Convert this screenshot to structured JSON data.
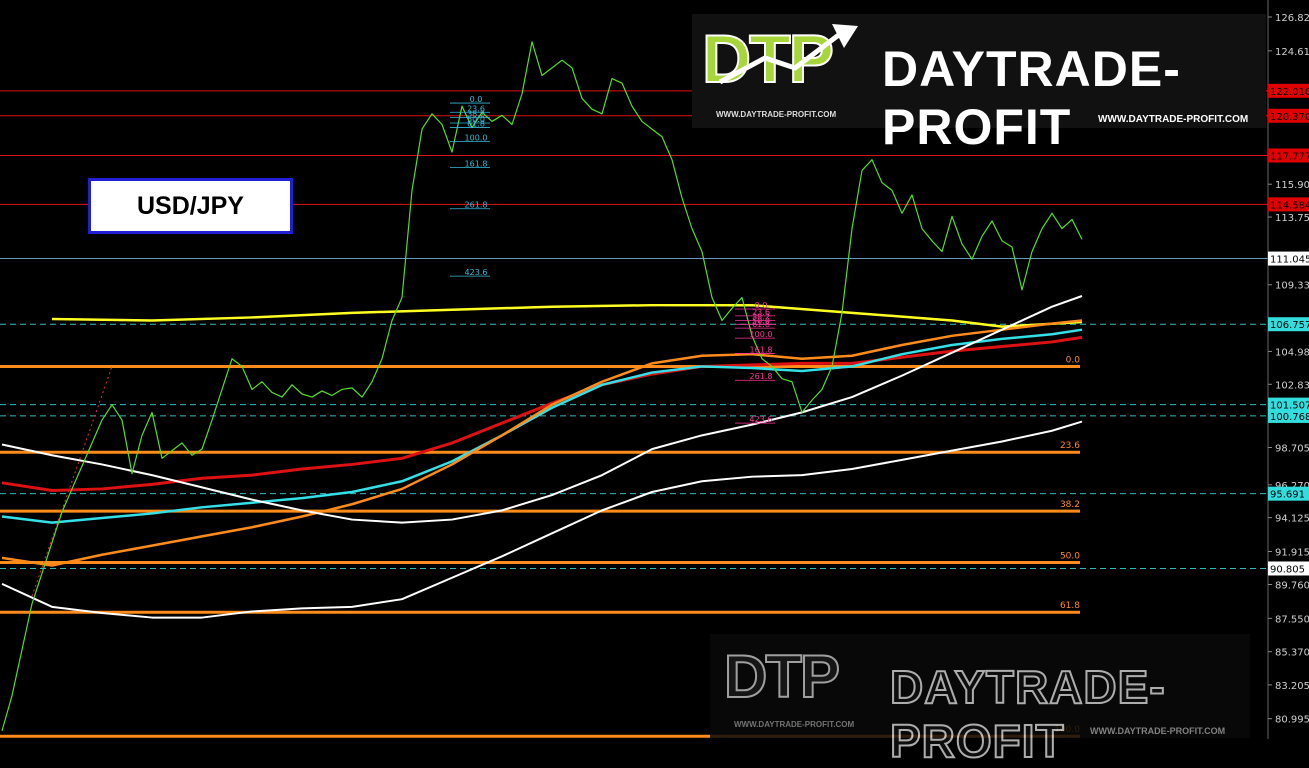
{
  "instrument": {
    "label": "USD/JPY"
  },
  "brand": {
    "name": "DAYTRADE-PROFIT",
    "mark": "DTP",
    "url": "WWW.DAYTRADE-PROFIT.COM",
    "url_small": "WWW.DAYTRADE-PROFIT.COM",
    "accent": "#a6d63a"
  },
  "chart_data": {
    "type": "line",
    "ylim": [
      79.8,
      127.8
    ],
    "y_ticks": [
      "126.820",
      "124.610",
      "122.010",
      "120.370",
      "117.777",
      "115.900",
      "113.755",
      "111.045",
      "109.335",
      "106.757",
      "104.980",
      "102.835",
      "101.507",
      "100.768",
      "98.705",
      "96.270",
      "95.691",
      "94.125",
      "91.915",
      "90.805",
      "89.760",
      "87.550",
      "85.370",
      "83.205",
      "80.995"
    ],
    "y_ticks_plain": [
      "126.820",
      "124.610",
      "115.900",
      "113.755",
      "109.335",
      "104.980",
      "102.835",
      "98.705",
      "96.270",
      "94.125",
      "91.915",
      "89.760",
      "87.550",
      "85.370",
      "83.205",
      "80.995"
    ],
    "price_labels": [
      {
        "text": "122.010",
        "value": 122.0,
        "color": "#e00000"
      },
      {
        "text": "120.370",
        "value": 120.37,
        "color": "#e00000"
      },
      {
        "text": "117.777",
        "value": 117.777,
        "color": "#e00000"
      },
      {
        "text": "114.584",
        "value": 114.584,
        "color": "#e00000"
      },
      {
        "text": "111.045",
        "value": 111.045,
        "color": "#ffffff"
      },
      {
        "text": "106.757",
        "value": 106.757,
        "color": "#33dddd"
      },
      {
        "text": "101.507",
        "value": 101.507,
        "color": "#33dddd"
      },
      {
        "text": "100.768",
        "value": 100.768,
        "color": "#33dddd"
      },
      {
        "text": "95.691",
        "value": 95.691,
        "color": "#33dddd"
      },
      {
        "text": "90.805",
        "value": 90.805,
        "color": "#ffffff"
      }
    ],
    "red_levels": [
      122.0,
      120.37,
      117.777,
      114.584
    ],
    "cyan_dashed_levels": [
      106.757,
      101.507,
      100.768,
      95.691,
      90.805
    ],
    "fib_levels": [
      {
        "label": "0.0",
        "value": 104.0
      },
      {
        "label": "23.6",
        "value": 98.4
      },
      {
        "label": "38.2",
        "value": 94.55
      },
      {
        "label": "50.0",
        "value": 91.2
      },
      {
        "label": "61.8",
        "value": 87.95
      },
      {
        "label": "100.0",
        "value": 79.85
      }
    ],
    "fib_ext_top": {
      "labels": [
        "0.0",
        "23.6",
        "38.2",
        "50.0",
        "61.8",
        "100.0",
        "161.8",
        "261.8",
        "423.6"
      ],
      "values": [
        121.2,
        120.6,
        120.25,
        119.9,
        119.6,
        118.7,
        117.0,
        114.3,
        109.9
      ],
      "color": "#33bbdd"
    },
    "fib_ext_mid": {
      "labels": [
        "0.0",
        "23.6",
        "38.2",
        "50.0",
        "61.8",
        "100.0",
        "161.8",
        "261.8",
        "423.6"
      ],
      "values": [
        107.75,
        107.3,
        107.0,
        106.75,
        106.5,
        105.85,
        104.85,
        103.1,
        100.3
      ],
      "color": "#ff3399"
    },
    "close_line": {
      "color": "#55dd22",
      "x": [
        0,
        10,
        20,
        30,
        40,
        50,
        60,
        70,
        80,
        90,
        100,
        110,
        120,
        130,
        140,
        150,
        160,
        170,
        180,
        190,
        200,
        210,
        220,
        230,
        240,
        250,
        260,
        270,
        280,
        290,
        300,
        310,
        320,
        330,
        340,
        350,
        360,
        370,
        380,
        390,
        400,
        410,
        420,
        430,
        440,
        450,
        460,
        470,
        480,
        490,
        500,
        510,
        520,
        530,
        540,
        550,
        560,
        570,
        580,
        590,
        600,
        610,
        620,
        630,
        640,
        650,
        660,
        670,
        680,
        690,
        700,
        710,
        720,
        730,
        740,
        750,
        760,
        770,
        780,
        790,
        800,
        810,
        820,
        830,
        840,
        850,
        860,
        870,
        880,
        890,
        900,
        910,
        920,
        930,
        940,
        950,
        960,
        970,
        980,
        990,
        1000,
        1010,
        1020,
        1030,
        1040,
        1050,
        1060,
        1070,
        1080
      ],
      "y": [
        80.2,
        82.5,
        85.5,
        88.5,
        90.5,
        92.5,
        94.5,
        96.0,
        97.5,
        99.0,
        100.5,
        101.5,
        100.5,
        97.0,
        99.5,
        101.0,
        98.0,
        98.5,
        99.0,
        98.2,
        98.6,
        100.5,
        102.5,
        104.5,
        104.0,
        102.5,
        103.0,
        102.3,
        102.0,
        102.8,
        102.2,
        102.0,
        102.4,
        102.1,
        102.5,
        102.6,
        102.0,
        103.0,
        104.5,
        107.0,
        108.5,
        115.5,
        119.5,
        120.5,
        119.8,
        118.0,
        121.0,
        119.6,
        120.6,
        120.0,
        120.4,
        119.8,
        121.8,
        125.2,
        123.0,
        123.5,
        124.0,
        123.5,
        121.5,
        120.8,
        120.5,
        122.8,
        122.5,
        121.0,
        120.0,
        119.5,
        119.0,
        117.5,
        115.0,
        113.0,
        111.5,
        108.5,
        107.0,
        107.8,
        108.5,
        106.0,
        104.5,
        104.0,
        103.2,
        103.0,
        101.0,
        101.8,
        102.5,
        104.0,
        107.5,
        113.0,
        116.8,
        117.5,
        116.0,
        115.5,
        114.0,
        115.2,
        113.0,
        112.2,
        111.5,
        113.8,
        112.0,
        111.0,
        112.5,
        113.5,
        112.2,
        111.8,
        109.0,
        111.5,
        113.0,
        114.0,
        113.0,
        113.6,
        112.3
      ]
    },
    "ma_lines": [
      {
        "color": "#ffff22",
        "width": 2.5,
        "x": [
          50,
          150,
          250,
          350,
          450,
          550,
          650,
          750,
          850,
          950,
          1000,
          1080
        ],
        "y": [
          107.1,
          107.0,
          107.2,
          107.5,
          107.7,
          107.9,
          108.0,
          108.0,
          107.5,
          107.0,
          106.6,
          106.9
        ]
      },
      {
        "color": "#dd1111",
        "width": 3,
        "x": [
          0,
          50,
          100,
          150,
          200,
          250,
          300,
          350,
          400,
          450,
          500,
          550,
          600,
          650,
          700,
          750,
          800,
          850,
          900,
          950,
          1000,
          1050,
          1080
        ],
        "y": [
          96.4,
          95.9,
          96.0,
          96.3,
          96.7,
          96.9,
          97.3,
          97.6,
          98.0,
          99.0,
          100.3,
          101.6,
          102.8,
          103.5,
          104.0,
          104.1,
          104.2,
          104.2,
          104.6,
          105.0,
          105.3,
          105.6,
          105.9
        ]
      },
      {
        "color": "#33e0e8",
        "width": 2.5,
        "x": [
          0,
          50,
          100,
          150,
          200,
          250,
          300,
          350,
          400,
          450,
          500,
          550,
          600,
          650,
          700,
          750,
          800,
          850,
          900,
          950,
          1000,
          1050,
          1080
        ],
        "y": [
          94.2,
          93.8,
          94.1,
          94.4,
          94.8,
          95.1,
          95.4,
          95.8,
          96.5,
          97.8,
          99.5,
          101.3,
          102.8,
          103.6,
          104.0,
          103.9,
          103.7,
          104.0,
          104.8,
          105.4,
          105.8,
          106.1,
          106.4
        ]
      },
      {
        "color": "#ff8c1a",
        "width": 2.5,
        "x": [
          0,
          50,
          100,
          150,
          200,
          250,
          300,
          350,
          400,
          450,
          500,
          550,
          600,
          650,
          700,
          750,
          800,
          850,
          900,
          950,
          1000,
          1050,
          1080
        ],
        "y": [
          91.5,
          91.0,
          91.7,
          92.3,
          92.9,
          93.5,
          94.2,
          95.0,
          96.0,
          97.6,
          99.5,
          101.5,
          103.0,
          104.2,
          104.7,
          104.8,
          104.5,
          104.7,
          105.4,
          106.0,
          106.4,
          106.8,
          107.0
        ]
      },
      {
        "color": "#ffffff",
        "width": 2,
        "x": [
          0,
          50,
          100,
          150,
          200,
          250,
          300,
          350,
          400,
          450,
          500,
          550,
          600,
          650,
          700,
          750,
          800,
          850,
          900,
          950,
          1000,
          1050,
          1080
        ],
        "y": [
          98.9,
          98.2,
          97.6,
          96.9,
          96.1,
          95.3,
          94.6,
          94.0,
          93.8,
          94.0,
          94.6,
          95.6,
          96.9,
          98.6,
          99.5,
          100.2,
          101.0,
          102.0,
          103.4,
          104.9,
          106.4,
          107.9,
          108.6
        ]
      },
      {
        "color": "#ffffff",
        "width": 2,
        "x": [
          0,
          50,
          100,
          150,
          200,
          250,
          300,
          350,
          400,
          450,
          500,
          550,
          600,
          650,
          700,
          750,
          800,
          850,
          900,
          950,
          1000,
          1050,
          1080
        ],
        "y": [
          89.8,
          88.3,
          87.9,
          87.6,
          87.6,
          88.0,
          88.2,
          88.3,
          88.8,
          90.2,
          91.6,
          93.1,
          94.6,
          95.8,
          96.5,
          96.8,
          96.9,
          97.3,
          97.9,
          98.5,
          99.1,
          99.8,
          100.4
        ]
      }
    ],
    "trend_dotted": {
      "color": "#dd3333",
      "x": [
        30,
        110
      ],
      "y": [
        89.0,
        104.0
      ]
    }
  }
}
